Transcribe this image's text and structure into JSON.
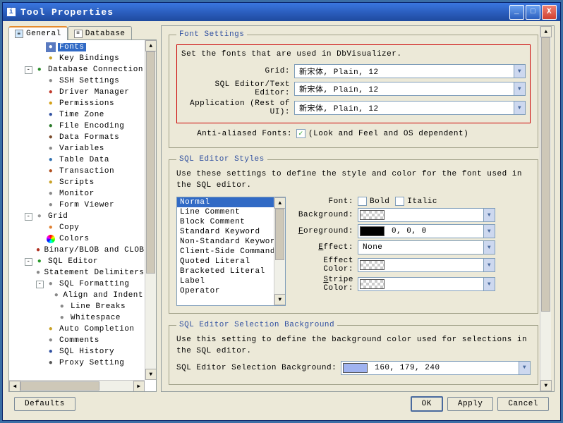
{
  "window": {
    "title": "Tool Properties"
  },
  "tabs": {
    "general": "General",
    "database": "Database"
  },
  "tree": [
    {
      "label": "Fonts",
      "depth": 2,
      "icon": "ic-font",
      "sel": true
    },
    {
      "label": "Key Bindings",
      "depth": 2,
      "icon": "ic-key"
    },
    {
      "label": "Database Connection",
      "depth": 1,
      "icon": "ic-db",
      "toggle": "-"
    },
    {
      "label": "SSH Settings",
      "depth": 2,
      "icon": "ic-doc"
    },
    {
      "label": "Driver Manager",
      "depth": 2,
      "icon": "ic-drv"
    },
    {
      "label": "Permissions",
      "depth": 2,
      "icon": "ic-perm"
    },
    {
      "label": "Time Zone",
      "depth": 2,
      "icon": "ic-time"
    },
    {
      "label": "File Encoding",
      "depth": 2,
      "icon": "ic-file"
    },
    {
      "label": "Data Formats",
      "depth": 2,
      "icon": "ic-data"
    },
    {
      "label": "Variables",
      "depth": 2,
      "icon": "ic-var"
    },
    {
      "label": "Table Data",
      "depth": 2,
      "icon": "ic-tbl"
    },
    {
      "label": "Transaction",
      "depth": 2,
      "icon": "ic-txn"
    },
    {
      "label": "Scripts",
      "depth": 2,
      "icon": "ic-scr"
    },
    {
      "label": "Monitor",
      "depth": 2,
      "icon": "ic-mon"
    },
    {
      "label": "Form Viewer",
      "depth": 2,
      "icon": "ic-form"
    },
    {
      "label": "Grid",
      "depth": 1,
      "icon": "ic-grid",
      "toggle": "-"
    },
    {
      "label": "Copy",
      "depth": 2,
      "icon": "ic-copy"
    },
    {
      "label": "Colors",
      "depth": 2,
      "icon": "rainbow"
    },
    {
      "label": "Binary/BLOB and CLOB Data",
      "depth": 2,
      "icon": "ic-bin"
    },
    {
      "label": "SQL Editor",
      "depth": 1,
      "icon": "ic-sql",
      "toggle": "-"
    },
    {
      "label": "Statement Delimiters",
      "depth": 2,
      "icon": "ic-doc"
    },
    {
      "label": "SQL Formatting",
      "depth": 2,
      "icon": "ic-fmt",
      "toggle": "-"
    },
    {
      "label": "Align and Indent",
      "depth": 3,
      "icon": "ic-sub"
    },
    {
      "label": "Line Breaks",
      "depth": 3,
      "icon": "ic-sub"
    },
    {
      "label": "Whitespace",
      "depth": 3,
      "icon": "ic-sub"
    },
    {
      "label": "Auto Completion",
      "depth": 2,
      "icon": "ic-auto"
    },
    {
      "label": "Comments",
      "depth": 2,
      "icon": "ic-cmt"
    },
    {
      "label": "SQL History",
      "depth": 2,
      "icon": "ic-hist"
    },
    {
      "label": "Proxy Setting",
      "depth": 2,
      "icon": "ic-proxy"
    }
  ],
  "font_settings": {
    "legend": "Font Settings",
    "desc": "Set the fonts that are used in DbVisualizer.",
    "rows": [
      {
        "label": "Grid:",
        "value": "新宋体, Plain, 12"
      },
      {
        "label": "SQL Editor/Text Editor:",
        "value": "新宋体, Plain, 12"
      },
      {
        "label": "Application (Rest of UI):",
        "value": "新宋体, Plain, 12"
      }
    ],
    "aa_label": "Anti-aliased Fonts:",
    "aa_note": "(Look and Feel and OS dependent)"
  },
  "sql_styles": {
    "legend": "SQL Editor Styles",
    "desc": "Use these settings to define the style and color for the font used in the SQL editor.",
    "list": [
      "Normal",
      "Line Comment",
      "Block Comment",
      "Standard Keyword",
      "Non-Standard Keyword",
      "Client-Side Command",
      "Quoted Literal",
      "Bracketed Literal",
      "Label",
      "Operator"
    ],
    "font_label": "Font:",
    "bold": "Bold",
    "italic": "Italic",
    "background_label": "Background:",
    "foreground_label": "Foreground:",
    "foreground_value": "0, 0, 0",
    "effect_label": "Effect:",
    "effect_value": "None",
    "effect_color_label": "Effect Color:",
    "stripe_label": "Stripe Color:"
  },
  "sql_selection": {
    "legend": "SQL Editor Selection Background",
    "desc": "Use this setting to define the background color used for selections in the SQL editor.",
    "label": "SQL Editor Selection Background:",
    "value": "160, 179, 240"
  },
  "buttons": {
    "defaults": "Defaults",
    "ok": "OK",
    "apply": "Apply",
    "cancel": "Cancel"
  }
}
